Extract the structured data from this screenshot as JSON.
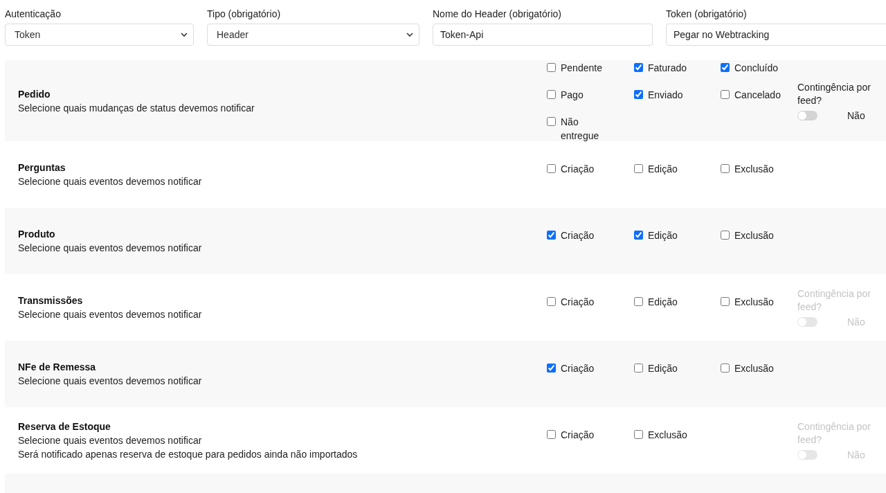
{
  "fields": [
    {
      "kind": "select",
      "label": "Autenticação",
      "value": "Token"
    },
    {
      "kind": "select",
      "label": "Tipo (obrigatório)",
      "value": "Header"
    },
    {
      "kind": "input",
      "label": "Nome do Header (obrigatório)",
      "value": "Token-Api"
    },
    {
      "kind": "input",
      "label": "Token (obrigatório)",
      "value": "Pegar no Webtracking"
    }
  ],
  "sections": [
    {
      "title": "Pedido",
      "descriptions": [
        "Selecione quais mudanças de status devemos notificar"
      ],
      "options": [
        {
          "label": "Pendente",
          "checked": false
        },
        {
          "label": "Faturado",
          "checked": true
        },
        {
          "label": "Concluído",
          "checked": true
        },
        {
          "label": "Pago",
          "checked": false
        },
        {
          "label": "Enviado",
          "checked": true
        },
        {
          "label": "Cancelado",
          "checked": false
        },
        {
          "label": "Não entregue",
          "checked": false
        }
      ],
      "contingency": {
        "label": "Contingência por feed?",
        "on": false,
        "disabled": false,
        "value": "Não"
      }
    },
    {
      "title": "Perguntas",
      "descriptions": [
        "Selecione quais eventos devemos notificar"
      ],
      "options": [
        {
          "label": "Criação",
          "checked": false
        },
        {
          "label": "Edição",
          "checked": false
        },
        {
          "label": "Exclusão",
          "checked": false
        }
      ]
    },
    {
      "title": "Produto",
      "descriptions": [
        "Selecione quais eventos devemos notificar"
      ],
      "options": [
        {
          "label": "Criação",
          "checked": true
        },
        {
          "label": "Edição",
          "checked": true
        },
        {
          "label": "Exclusão",
          "checked": false
        }
      ]
    },
    {
      "title": "Transmissões",
      "descriptions": [
        "Selecione quais eventos devemos notificar"
      ],
      "options": [
        {
          "label": "Criação",
          "checked": false
        },
        {
          "label": "Edição",
          "checked": false
        },
        {
          "label": "Exclusão",
          "checked": false
        }
      ],
      "contingency": {
        "label": "Contingência por feed?",
        "on": false,
        "disabled": true,
        "value": "Não"
      }
    },
    {
      "title": "NFe de Remessa",
      "descriptions": [
        "Selecione quais eventos devemos notificar"
      ],
      "options": [
        {
          "label": "Criação",
          "checked": true
        },
        {
          "label": "Edição",
          "checked": false
        },
        {
          "label": "Exclusão",
          "checked": false
        }
      ]
    },
    {
      "title": "Reserva de Estoque",
      "descriptions": [
        "Selecione quais eventos devemos notificar",
        "Será notificado apenas reserva de estoque para pedidos ainda não importados"
      ],
      "options": [
        {
          "label": "Criação",
          "checked": false
        },
        {
          "label": "Exclusão",
          "checked": false
        }
      ],
      "contingency": {
        "label": "Contingência por feed?",
        "on": false,
        "disabled": true,
        "value": "Não"
      }
    }
  ]
}
